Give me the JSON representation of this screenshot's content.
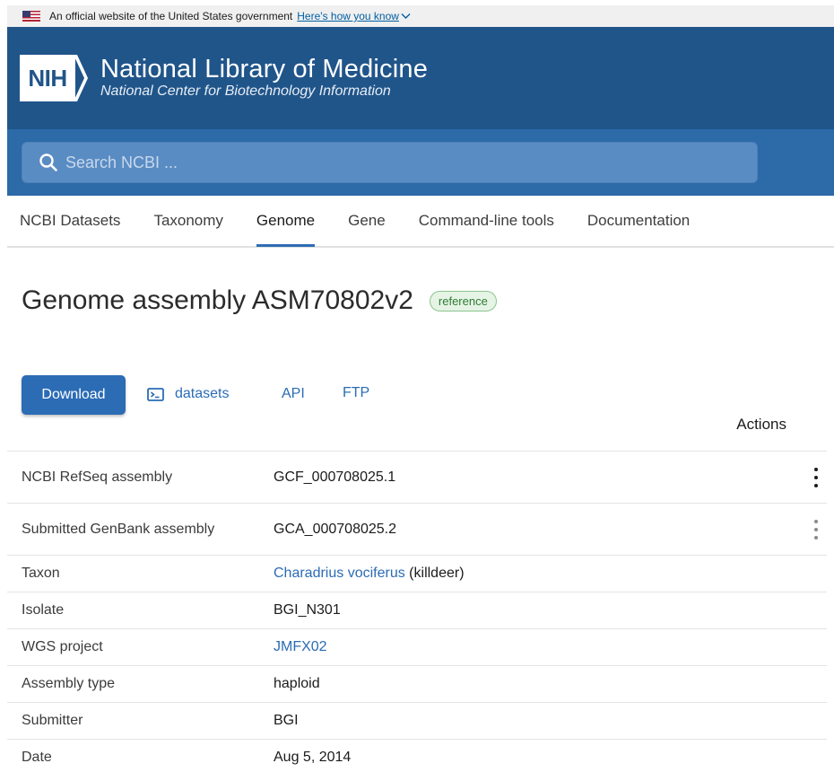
{
  "gov_banner": {
    "text": "An official website of the United States government",
    "link": "Here's how you know"
  },
  "header": {
    "logo_text": "NIH",
    "title": "National Library of Medicine",
    "subtitle": "National Center for Biotechnology Information",
    "brand_color": "#20558a"
  },
  "search": {
    "placeholder": "Search NCBI ...",
    "value": ""
  },
  "nav": {
    "items": [
      {
        "label": "NCBI Datasets"
      },
      {
        "label": "Taxonomy"
      },
      {
        "label": "Genome"
      },
      {
        "label": "Gene"
      },
      {
        "label": "Command-line tools"
      },
      {
        "label": "Documentation"
      }
    ],
    "active": "Genome"
  },
  "page": {
    "title": "Genome assembly ASM70802v2",
    "badge": "reference"
  },
  "actions": {
    "download_label": "Download",
    "datasets_label": "datasets",
    "api_label": "API",
    "ftp_label": "FTP",
    "actions_header": "Actions"
  },
  "table": {
    "rows": [
      {
        "label": "NCBI RefSeq assembly",
        "value": "GCF_000708025.1"
      },
      {
        "label": "Submitted GenBank assembly",
        "value": "GCA_000708025.2"
      },
      {
        "label": "Taxon",
        "value_link": "Charadrius vociferus",
        "value_suffix": " (killdeer)"
      },
      {
        "label": "Isolate",
        "value": "BGI_N301"
      },
      {
        "label": "WGS project",
        "value_link": "JMFX02"
      },
      {
        "label": "Assembly type",
        "value": "haploid"
      },
      {
        "label": "Submitter",
        "value": "BGI"
      },
      {
        "label": "Date",
        "value": "Aug 5, 2014"
      }
    ]
  },
  "icons": {
    "flag": "us-flag-icon",
    "chevron": "chevron-down-icon",
    "search": "search-icon",
    "terminal": "terminal-icon",
    "more": "more-vertical-icon"
  }
}
